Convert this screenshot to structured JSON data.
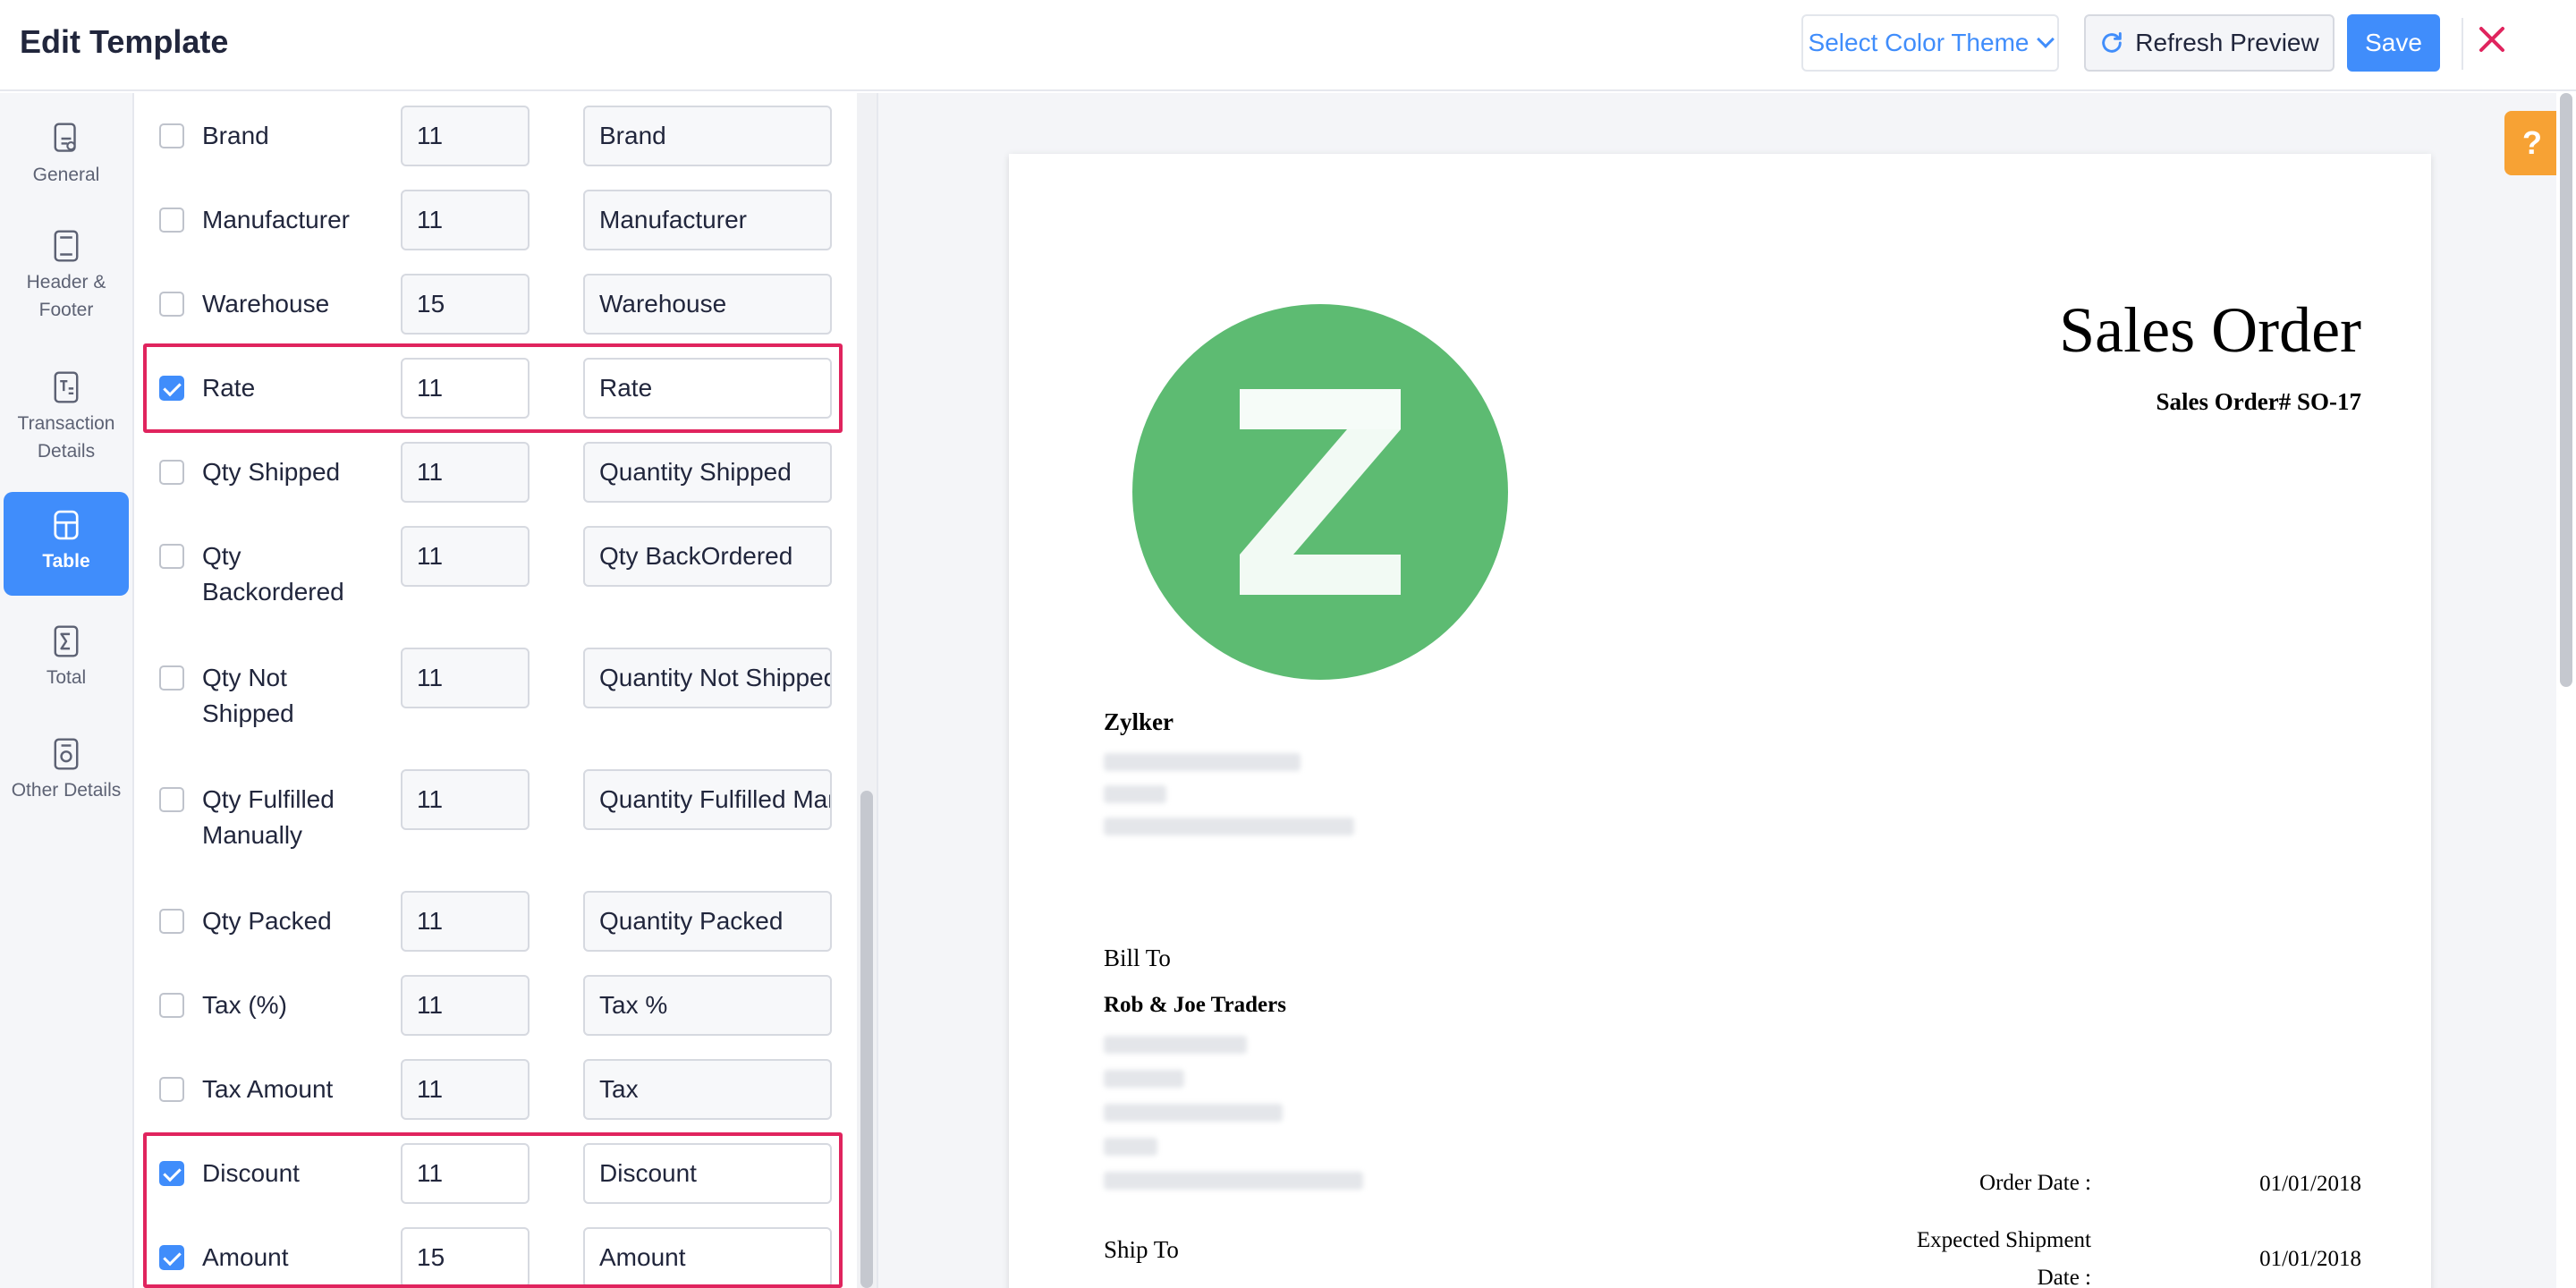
{
  "header": {
    "title": "Edit Template",
    "color_theme_label": "Select Color Theme",
    "refresh_label": "Refresh Preview",
    "save_label": "Save"
  },
  "nav": {
    "items": [
      {
        "label": "General",
        "icon": "general-icon"
      },
      {
        "label": "Header & Footer",
        "icon": "header-footer-icon"
      },
      {
        "label": "Transaction Details",
        "icon": "transaction-details-icon"
      },
      {
        "label": "Table",
        "icon": "table-icon",
        "active": true
      },
      {
        "label": "Total",
        "icon": "sigma-icon"
      },
      {
        "label": "Other Details",
        "icon": "other-details-icon"
      }
    ]
  },
  "fields": [
    {
      "label": "Brand",
      "checked": false,
      "size": "11",
      "name": "Brand"
    },
    {
      "label": "Manufacturer",
      "checked": false,
      "size": "11",
      "name": "Manufacturer"
    },
    {
      "label": "Warehouse",
      "checked": false,
      "size": "15",
      "name": "Warehouse"
    },
    {
      "label": "Rate",
      "checked": true,
      "size": "11",
      "name": "Rate"
    },
    {
      "label": "Qty Shipped",
      "checked": false,
      "size": "11",
      "name": "Quantity Shipped"
    },
    {
      "label": "Qty Backordered",
      "checked": false,
      "size": "11",
      "name": "Qty BackOrdered"
    },
    {
      "label": "Qty Not Shipped",
      "checked": false,
      "size": "11",
      "name": "Quantity Not Shipped"
    },
    {
      "label": "Qty Fulfilled Manually",
      "checked": false,
      "size": "11",
      "name": "Quantity Fulfilled Manually"
    },
    {
      "label": "Qty Packed",
      "checked": false,
      "size": "11",
      "name": "Quantity Packed"
    },
    {
      "label": "Tax (%)",
      "checked": false,
      "size": "11",
      "name": "Tax %"
    },
    {
      "label": "Tax Amount",
      "checked": false,
      "size": "11",
      "name": "Tax"
    },
    {
      "label": "Discount",
      "checked": true,
      "size": "11",
      "name": "Discount"
    },
    {
      "label": "Amount",
      "checked": true,
      "size": "15",
      "name": "Amount"
    }
  ],
  "preview": {
    "doc_title": "Sales Order",
    "doc_number": "Sales Order# SO-17",
    "company": "Zylker",
    "bill_to_label": "Bill To",
    "client": "Rob & Joe Traders",
    "ship_to_label": "Ship To",
    "order_date_label": "Order Date :",
    "order_date": "01/01/2018",
    "expected_shipment_label": "Expected Shipment Date :",
    "expected_shipment_date": "01/01/2018"
  },
  "colors": {
    "accent": "#408dfb",
    "highlight": "#e0245e",
    "logo": "#5dbb72",
    "help": "#f7a234",
    "close": "#e0245e"
  },
  "help_label": "?"
}
